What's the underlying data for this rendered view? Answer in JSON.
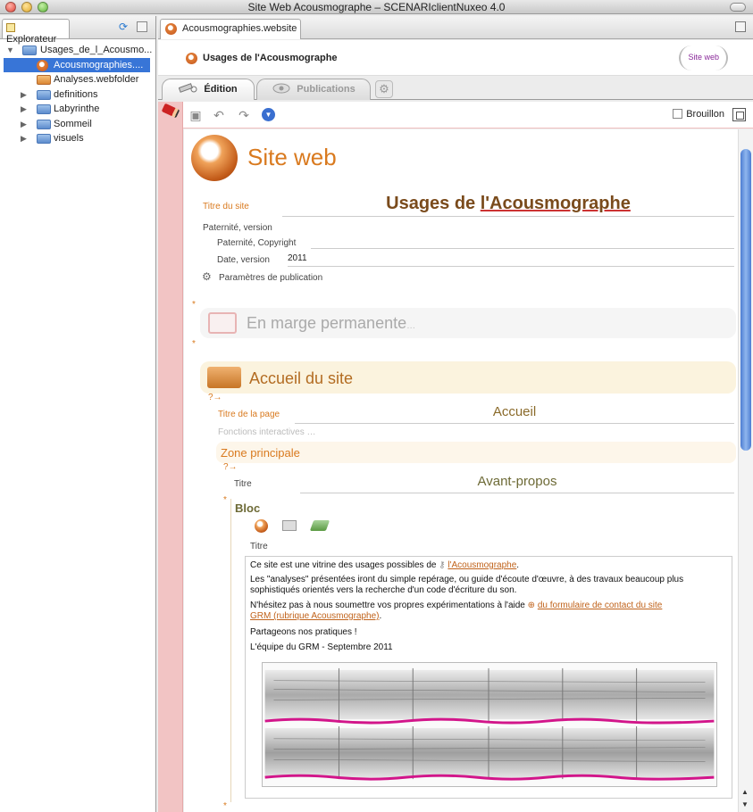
{
  "window": {
    "title": "Site Web Acousmographe – SCENARIclientNuxeo 4.0"
  },
  "explorer": {
    "tab_label": "Explorateur",
    "tree": [
      {
        "label": "Usages_de_l_Acousmo...",
        "icon": "folder-icon",
        "expanded": true
      },
      {
        "label": "Acousmographies....",
        "icon": "website-icon",
        "selected": true
      },
      {
        "label": "Analyses.webfolder",
        "icon": "webfolder-icon"
      },
      {
        "label": "definitions",
        "icon": "folder-icon"
      },
      {
        "label": "Labyrinthe",
        "icon": "folder-icon"
      },
      {
        "label": "Sommeil",
        "icon": "folder-icon"
      },
      {
        "label": "visuels",
        "icon": "folder-icon"
      }
    ]
  },
  "editor": {
    "tab_label": "Acousmographies.website",
    "header_title": "Usages de l'Acousmographe",
    "badge": "Site web",
    "mode_tabs": {
      "edition": "Édition",
      "publications": "Publications"
    },
    "brouillon": "Brouillon"
  },
  "doc": {
    "heading": "Site web",
    "site_title_label": "Titre du site",
    "site_title_prefix": "Usages de ",
    "site_title_link": "l'Acousmographe",
    "paternite_label": "Paternité, version",
    "copyright_label": "Paternité, Copyright",
    "copyright_value": "",
    "date_label": "Date, version",
    "date_value": "2011",
    "params_label": "Paramètres de publication",
    "marge_label": "En marge permanente",
    "marge_dots": "…",
    "accueil_label": "Accueil du site",
    "help_marker": "?→",
    "page_title_label": "Titre de la page",
    "page_title_value": "Accueil",
    "fonctions_label": "Fonctions interactives …",
    "zone_label": "Zone principale",
    "zone_title_label": "Titre",
    "zone_title_value": "Avant-propos",
    "bloc_label": "Bloc",
    "bloc_title_label": "Titre",
    "text": {
      "p1_a": "Ce site est une vitrine des usages possibles de ",
      "p1_link": "l'Acousmographe",
      "p1_b": ".",
      "p2": "Les \"analyses\" présentées iront du simple repérage, ou guide d'écoute d'œuvre, à des travaux beaucoup plus",
      "p2b": "sophistiqués orientés vers la recherche d'un code d'écriture du son.",
      "p3_a": "N'hésitez pas à nous soumettre vos propres expérimentations à l'aide ",
      "p3_link1": "du formulaire de contact du site",
      "p3_link2": "GRM (rubrique Acousmographe)",
      "p3_b": ".",
      "p4": "Partageons nos pratiques !",
      "p5": "L'équipe du GRM - Septembre 2011"
    }
  },
  "colors": {
    "accent_orange": "#d97a1f",
    "selection_blue": "#3875d7",
    "margin_pink": "#f2c4c4",
    "spectrogram_magenta": "#d2158a"
  }
}
